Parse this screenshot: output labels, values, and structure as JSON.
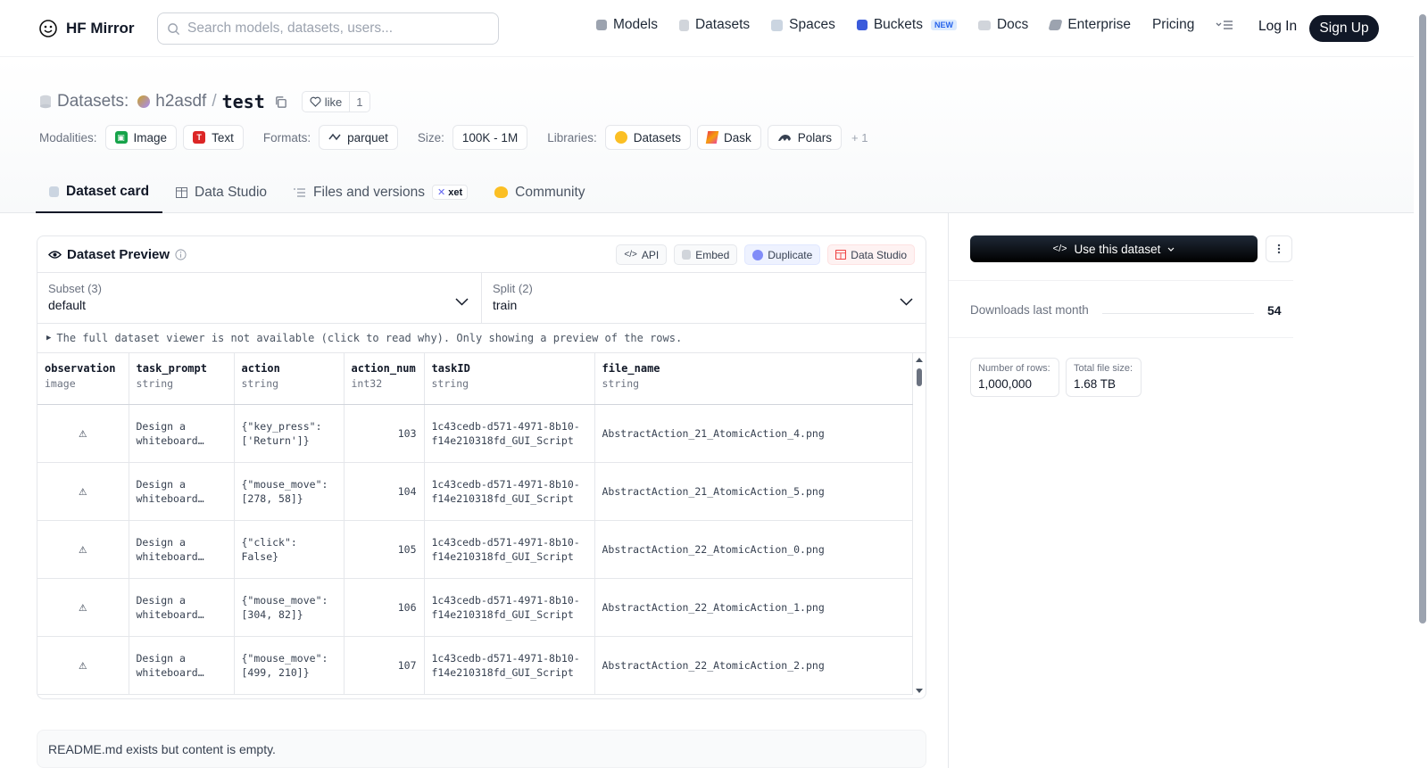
{
  "nav": {
    "brand": "HF Mirror",
    "search_placeholder": "Search models, datasets, users...",
    "links": [
      {
        "label": "Models",
        "icon": "models-icon"
      },
      {
        "label": "Datasets",
        "icon": "datasets-icon"
      },
      {
        "label": "Spaces",
        "icon": "spaces-icon"
      },
      {
        "label": "Buckets",
        "icon": "buckets-icon",
        "badge": "NEW"
      },
      {
        "label": "Docs",
        "icon": "docs-icon"
      },
      {
        "label": "Enterprise",
        "icon": "enterprise-icon"
      },
      {
        "label": "Pricing"
      }
    ],
    "login": "Log In",
    "signup": "Sign Up"
  },
  "repo": {
    "section": "Datasets:",
    "owner": "h2asdf",
    "separator": "/",
    "name": "test",
    "like_label": "like",
    "like_count": "1"
  },
  "meta": {
    "modalities_label": "Modalities:",
    "modalities": [
      "Image",
      "Text"
    ],
    "formats_label": "Formats:",
    "formats": [
      "parquet"
    ],
    "size_label": "Size:",
    "size": "100K - 1M",
    "libraries_label": "Libraries:",
    "libraries": [
      "Datasets",
      "Dask",
      "Polars"
    ],
    "libraries_more": "+ 1"
  },
  "tabs": [
    {
      "label": "Dataset card",
      "active": true
    },
    {
      "label": "Data Studio"
    },
    {
      "label": "Files and versions",
      "badge": "xet"
    },
    {
      "label": "Community"
    }
  ],
  "preview": {
    "title": "Dataset Preview",
    "actions": [
      "API",
      "Embed",
      "Duplicate",
      "Data Studio"
    ],
    "subset_label": "Subset (3)",
    "subset_value": "default",
    "split_label": "Split (2)",
    "split_value": "train",
    "notice": "The full dataset viewer is not available (click to read why). Only showing a preview of the rows.",
    "columns": [
      {
        "name": "observation",
        "type": "image"
      },
      {
        "name": "task_prompt",
        "type": "string"
      },
      {
        "name": "action",
        "type": "string"
      },
      {
        "name": "action_num",
        "type": "int32"
      },
      {
        "name": "taskID",
        "type": "string"
      },
      {
        "name": "file_name",
        "type": "string"
      }
    ],
    "rows": [
      {
        "task_prompt": [
          "Design a",
          "whiteboard…"
        ],
        "action": [
          "{\"key_press\":",
          "['Return']}"
        ],
        "action_num": "103",
        "taskID": [
          "1c43cedb-d571-4971-8b10-",
          "f14e210318fd_GUI_Script"
        ],
        "file_name": "AbstractAction_21_AtomicAction_4.png"
      },
      {
        "task_prompt": [
          "Design a",
          "whiteboard…"
        ],
        "action": [
          "{\"mouse_move\":",
          "[278, 58]}"
        ],
        "action_num": "104",
        "taskID": [
          "1c43cedb-d571-4971-8b10-",
          "f14e210318fd_GUI_Script"
        ],
        "file_name": "AbstractAction_21_AtomicAction_5.png"
      },
      {
        "task_prompt": [
          "Design a",
          "whiteboard…"
        ],
        "action": [
          "{\"click\":",
          "False}"
        ],
        "action_num": "105",
        "taskID": [
          "1c43cedb-d571-4971-8b10-",
          "f14e210318fd_GUI_Script"
        ],
        "file_name": "AbstractAction_22_AtomicAction_0.png"
      },
      {
        "task_prompt": [
          "Design a",
          "whiteboard…"
        ],
        "action": [
          "{\"mouse_move\":",
          "[304, 82]}"
        ],
        "action_num": "106",
        "taskID": [
          "1c43cedb-d571-4971-8b10-",
          "f14e210318fd_GUI_Script"
        ],
        "file_name": "AbstractAction_22_AtomicAction_1.png"
      },
      {
        "task_prompt": [
          "Design a",
          "whiteboard…"
        ],
        "action": [
          "{\"mouse_move\":",
          "[499, 210]}"
        ],
        "action_num": "107",
        "taskID": [
          "1c43cedb-d571-4971-8b10-",
          "f14e210318fd_GUI_Script"
        ],
        "file_name": "AbstractAction_22_AtomicAction_2.png"
      }
    ]
  },
  "readme": "README.md exists but content is empty.",
  "sidebar": {
    "use_button": "Use this dataset",
    "downloads_label": "Downloads last month",
    "downloads_value": "54",
    "rows_label": "Number of rows:",
    "rows_value": "1,000,000",
    "filesize_label": "Total file size:",
    "filesize_value": "1.68 TB"
  }
}
